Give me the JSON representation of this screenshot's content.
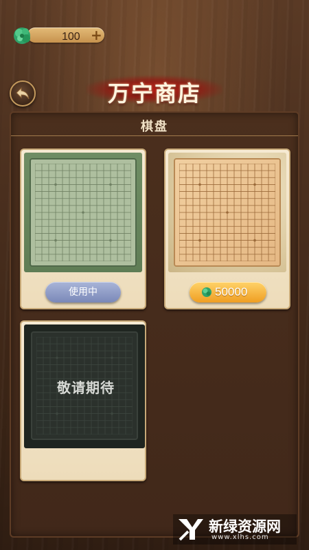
{
  "wallet": {
    "currency_icon": "jade-coin-icon",
    "amount": "100",
    "add_icon": "+"
  },
  "nav": {
    "back_icon": "back-arrow-icon"
  },
  "title": "万宁商店",
  "section": {
    "title": "棋盘"
  },
  "items": [
    {
      "theme": "green",
      "status_label": "使用中"
    },
    {
      "theme": "wood",
      "price": "50000",
      "price_icon": "jade-coin-icon"
    },
    {
      "theme": "dark",
      "placeholder": "敬请期待"
    }
  ],
  "watermark": {
    "name": "新绿资源网",
    "url": "www.xlhs.com"
  },
  "colors": {
    "accent_gold": "#ef9e22",
    "in_use_blue": "#7a88b8",
    "title_red": "#be1914"
  }
}
